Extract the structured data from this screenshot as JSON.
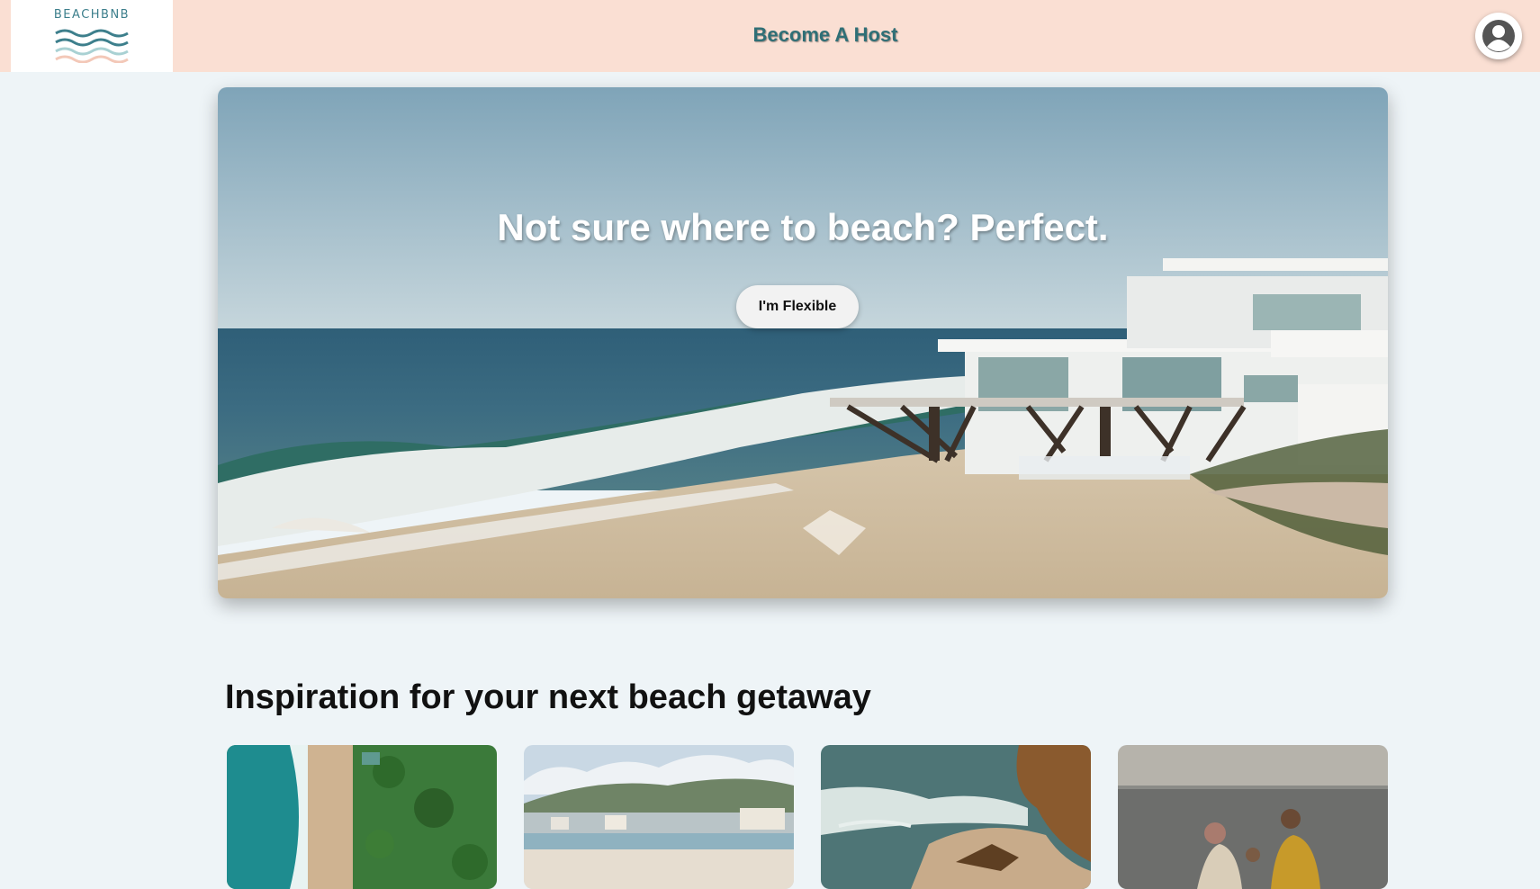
{
  "header": {
    "logo_text": "BEACHBNB",
    "host_link": "Become A Host",
    "avatar_icon": "user-avatar-icon"
  },
  "hero": {
    "title": "Not sure where to beach? Perfect.",
    "button_label": "I'm Flexible"
  },
  "inspiration": {
    "title": "Inspiration for your next beach getaway",
    "cards": [
      {
        "image": "aerial beach with palm trees"
      },
      {
        "image": "coastal town beach"
      },
      {
        "image": "rocky shoreline"
      },
      {
        "image": "family on beach"
      }
    ]
  },
  "colors": {
    "header_bg": "#fadfd3",
    "page_bg": "#eef4f7",
    "accent": "#2f6f76"
  }
}
